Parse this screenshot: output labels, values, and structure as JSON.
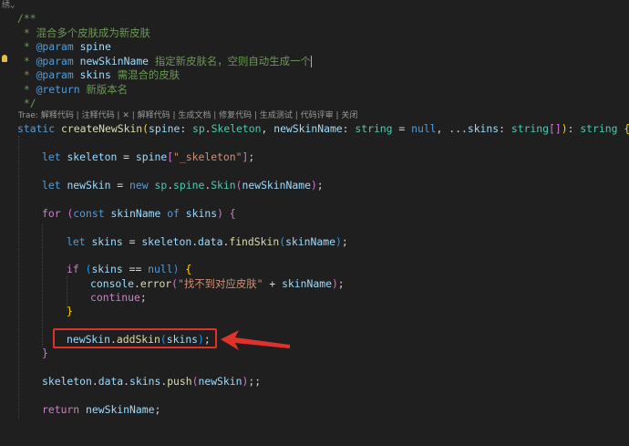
{
  "editor": {
    "fold_indicator": "绣⌄",
    "lines": {
      "comment_open": "/**",
      "c1_star": " * ",
      "c1_text": "混合多个皮肤成为新皮肤",
      "c2_tag": "@param",
      "c2_param": "spine",
      "c3_tag": "@param",
      "c3_param": "newSkinName",
      "c3_text": "指定新皮肤名，空则自动生成一个",
      "c4_tag": "@param",
      "c4_param": "skins",
      "c4_text": "需混合的皮肤",
      "c5_tag": "@return",
      "c5_text": "新版本名",
      "comment_close": " */",
      "codelens": "Trae: 解释代码 | 注释代码 | ✕ | 解释代码 | 生成文档 | 修复代码 | 生成测试 | 代码评审 | 关闭",
      "sig_static": "static",
      "sig_fn": "createNewSkin",
      "sig_spine": "spine",
      "sig_sp": "sp",
      "sig_skeleton_type": "Skeleton",
      "sig_newSkinName": "newSkinName",
      "sig_string": "string",
      "sig_null": "null",
      "sig_skins": "skins",
      "sig_string_arr": "string",
      "sig_ret": "string",
      "l_let1": "let",
      "l_skeleton": "skeleton",
      "l_spine": "spine",
      "l_skel_str": "\"_skeleton\"",
      "l_let2": "let",
      "l_newSkin": "newSkin",
      "l_new": "new",
      "l_sp2": "sp",
      "l_spine2": "spine",
      "l_Skin": "Skin",
      "l_newSkinName_arg": "newSkinName",
      "l_for": "for",
      "l_const": "const",
      "l_skinName": "skinName",
      "l_of": "of",
      "l_skins_iter": "skins",
      "l_let3": "let",
      "l_skins_var": "skins",
      "l_skeleton2": "skeleton",
      "l_data": "data",
      "l_findSkin": "findSkin",
      "l_skinName_arg": "skinName",
      "l_if": "if",
      "l_skins_cond": "skins",
      "l_null2": "null",
      "l_console": "console",
      "l_error": "error",
      "l_err_str": "\"找不到对应皮肤\"",
      "l_skinName_arg2": "skinName",
      "l_continue": "continue",
      "l_newSkin2": "newSkin",
      "l_addSkin": "addSkin",
      "l_skins_arg": "skins",
      "l_skeleton3": "skeleton",
      "l_data2": "data",
      "l_skins_prop": "skins",
      "l_push": "push",
      "l_newSkin3": "newSkin",
      "l_return": "return",
      "l_newSkinName_ret": "newSkinName"
    }
  },
  "colors": {
    "background": "#1f1f1f",
    "annotation": "#e0322c"
  }
}
